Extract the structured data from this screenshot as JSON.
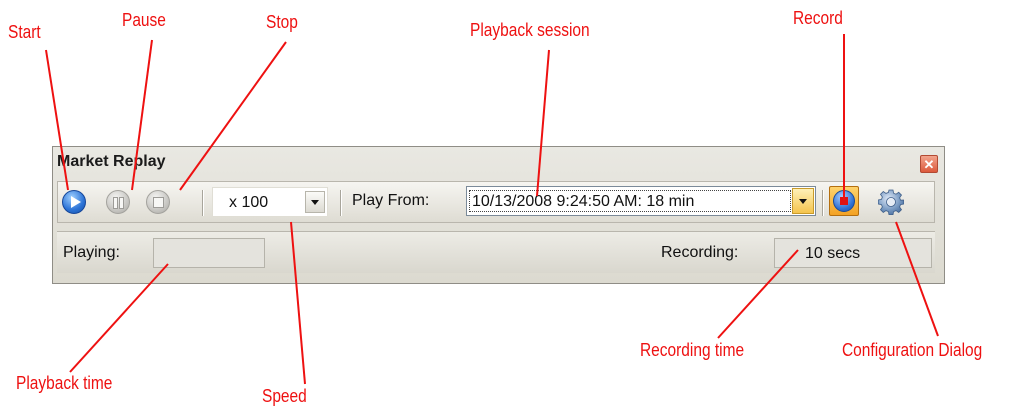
{
  "callouts": {
    "start": "Start",
    "pause": "Pause",
    "stop": "Stop",
    "playback_session": "Playback session",
    "record": "Record",
    "playback_time": "Playback time",
    "speed": "Speed",
    "recording_time": "Recording time",
    "configuration_dialog": "Configuration Dialog"
  },
  "window": {
    "title": "Market Replay",
    "close_glyph": "✕"
  },
  "toolbar": {
    "speed_value": "x 100",
    "play_from_label": "Play From:",
    "session_value": "10/13/2008 9:24:50 AM: 18 min"
  },
  "status": {
    "playing_label": "Playing:",
    "playing_value": "",
    "recording_label": "Recording:",
    "recording_value": "10 secs"
  },
  "icons": {
    "start": "play-icon",
    "pause": "pause-icon",
    "stop": "stop-icon",
    "record": "record-icon",
    "config": "gear-icon",
    "dropdown": "chevron-down-icon",
    "close": "close-icon"
  },
  "colors": {
    "callout": "#ee1111",
    "accent_blue": "#2c73d6",
    "record_red": "#e01212"
  }
}
